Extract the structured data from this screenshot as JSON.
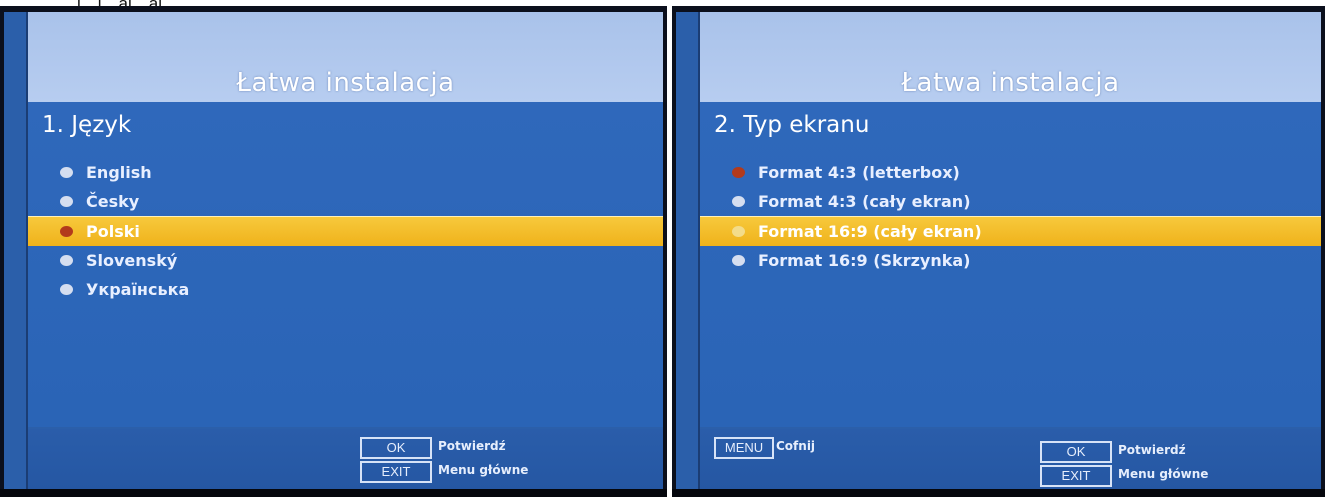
{
  "caption": "…j…j…aj…aj…",
  "left_screen": {
    "title": "Łatwa instalacja",
    "section": "1. Język",
    "options": [
      {
        "label": "English",
        "selected": false
      },
      {
        "label": "Česky",
        "selected": false
      },
      {
        "label": "Polski",
        "selected": true
      },
      {
        "label": "Slovenský",
        "selected": false
      },
      {
        "label": "Українська",
        "selected": false
      }
    ],
    "footer": {
      "ok_key": "OK",
      "ok_label": "Potwierdź",
      "exit_key": "EXIT",
      "exit_label": "Menu główne"
    }
  },
  "right_screen": {
    "title": "Łatwa instalacja",
    "section": "2. Typ ekranu",
    "options": [
      {
        "label": "Format 4:3 (letterbox)",
        "selected": false,
        "red_dot": true
      },
      {
        "label": "Format 4:3 (cały ekran)",
        "selected": false
      },
      {
        "label": "Format 16:9 (cały ekran)",
        "selected": true
      },
      {
        "label": "Format 16:9 (Skrzynka)",
        "selected": false
      }
    ],
    "footer": {
      "menu_key": "MENU",
      "menu_label": "Cofnij",
      "ok_key": "OK",
      "ok_label": "Potwierdź",
      "exit_key": "EXIT",
      "exit_label": "Menu główne"
    }
  },
  "colors": {
    "menu_blue": "#2f68bb",
    "header_light_blue": "#b7cdf0",
    "highlight_yellow": "#f7c93c",
    "selected_dot_red": "#b23a1c"
  }
}
